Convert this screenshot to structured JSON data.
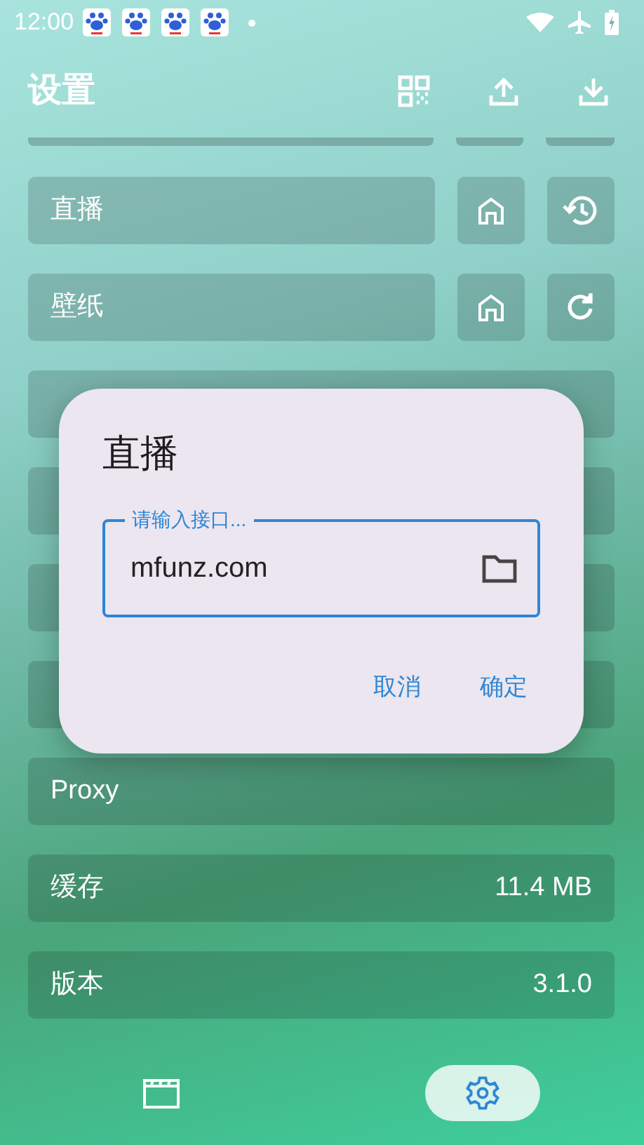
{
  "status_bar": {
    "time": "12:00"
  },
  "header": {
    "title": "设置"
  },
  "rows": [
    {
      "kind": "buttons",
      "label": "直播",
      "buttons": [
        {
          "kind": "home"
        },
        {
          "kind": "history"
        }
      ]
    },
    {
      "kind": "buttons",
      "label": "壁纸",
      "buttons": [
        {
          "kind": "home"
        },
        {
          "kind": "refresh"
        }
      ]
    },
    {
      "kind": "plain"
    },
    {
      "kind": "plain"
    },
    {
      "kind": "plain"
    },
    {
      "kind": "plain"
    },
    {
      "kind": "plain",
      "label": "Proxy"
    },
    {
      "kind": "value",
      "label": "缓存",
      "value": "11.4 MB"
    },
    {
      "kind": "value",
      "label": "版本",
      "value": "3.1.0"
    }
  ],
  "dialog": {
    "title": "直播",
    "field": {
      "label": "请输入接口...",
      "value": "mfunz.com"
    },
    "actions": [
      "取消",
      "确定"
    ]
  },
  "bottom_nav": [
    {
      "kind": "movies",
      "selected": false
    },
    {
      "kind": "settings",
      "selected": true
    }
  ]
}
